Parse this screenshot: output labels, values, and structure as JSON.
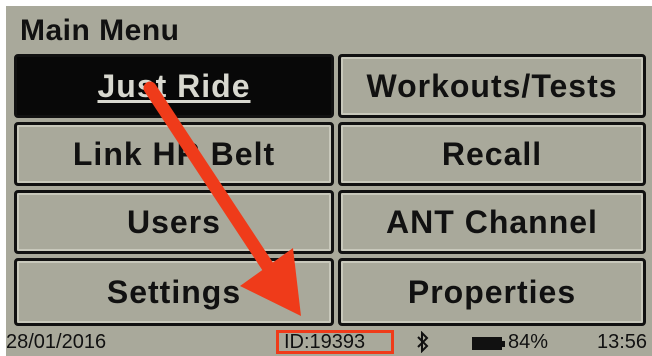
{
  "menu": {
    "title": "Main Menu",
    "items": [
      {
        "label": "Just Ride",
        "selected": true
      },
      {
        "label": "Workouts/Tests"
      },
      {
        "label": "Link HR Belt"
      },
      {
        "label": "Recall"
      },
      {
        "label": "Users"
      },
      {
        "label": "ANT Channel"
      },
      {
        "label": "Settings"
      },
      {
        "label": "Properties"
      }
    ]
  },
  "status": {
    "date": "28/01/2016",
    "device_id": "ID:19393",
    "bluetooth_icon": "bluetooth-icon",
    "battery_icon": "battery-icon",
    "battery_percent": "84%",
    "time": "13:56"
  },
  "colors": {
    "screen_bg": "#a9a99b",
    "annotation": "#ef3b1a"
  }
}
